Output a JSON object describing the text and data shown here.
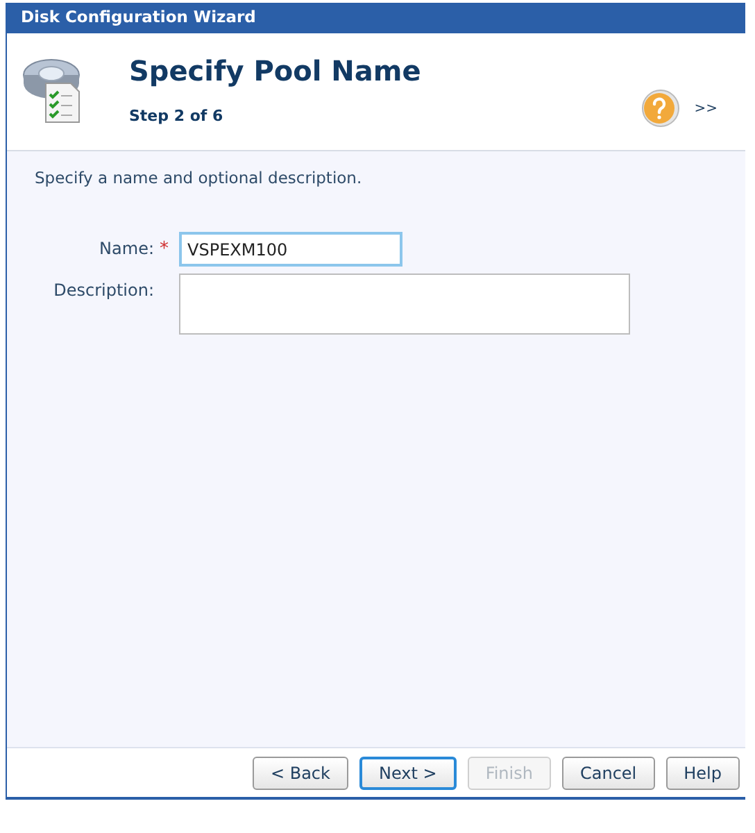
{
  "window": {
    "title": "Disk Configuration Wizard"
  },
  "header": {
    "title": "Specify Pool Name",
    "step": "Step 2 of 6",
    "more": ">>"
  },
  "intro": "Specify a name and optional description.",
  "fields": [
    {
      "label": "Name:",
      "required": true,
      "kind": "text",
      "value": "VSPEXM100",
      "focused": true
    },
    {
      "label": "Description:",
      "required": false,
      "kind": "textarea",
      "focused": false
    }
  ],
  "required_mark": "*",
  "buttons": [
    {
      "label": "< Back",
      "disabled": false,
      "focused": false
    },
    {
      "label": "Next >",
      "disabled": false,
      "focused": true
    },
    {
      "label": "Finish",
      "disabled": true,
      "focused": false
    },
    {
      "label": "Cancel",
      "disabled": false,
      "focused": false
    },
    {
      "label": "Help",
      "disabled": false,
      "focused": false
    }
  ]
}
